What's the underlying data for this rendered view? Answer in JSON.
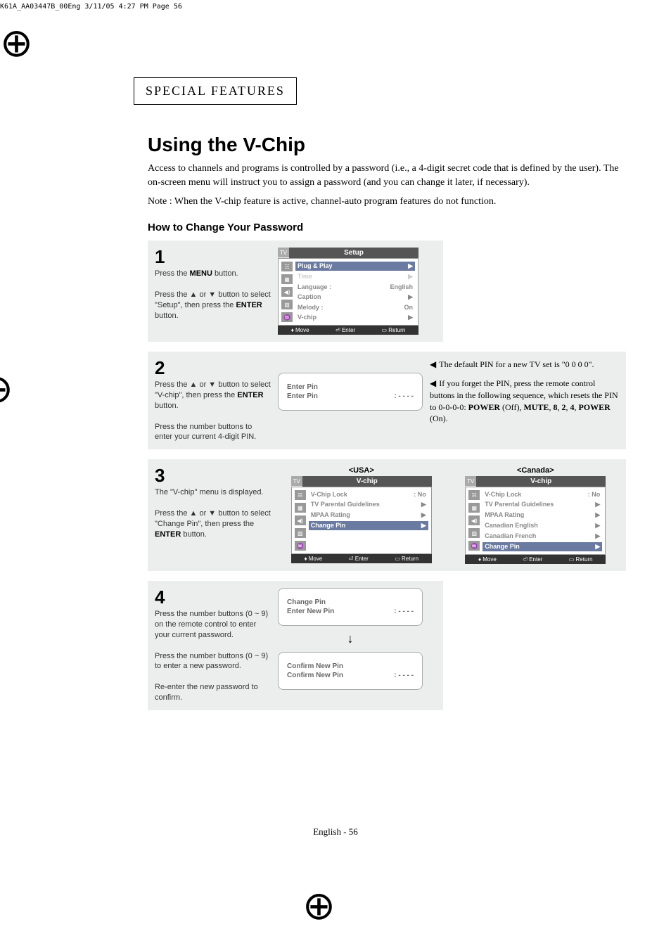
{
  "top_meta": "K61A_AA03447B_00Eng  3/11/05  4:27 PM  Page 56",
  "section_header": "SPECIAL FEATURES",
  "main_title": "Using the V-Chip",
  "intro": "Access to channels and programs is controlled by a password (i.e., a 4-digit secret code that is defined by the user). The on-screen menu will instruct you to assign a password (and you can change it later, if necessary).",
  "note": "Note : When the V-chip feature is active, channel-auto program features do not function.",
  "sub_heading": "How to Change Your Password",
  "step1": {
    "num": "1",
    "line1_pre": "Press the ",
    "line1_bold": "MENU",
    "line1_post": " button.",
    "line2_pre": "Press the ▲ or ▼ button to select \"Setup\", then press the ",
    "line2_bold": "ENTER",
    "line2_post": " button."
  },
  "osd_setup": {
    "title": "Setup",
    "items": [
      {
        "label": "Plug & Play",
        "val": "",
        "sel": true,
        "arrow": "▶"
      },
      {
        "label": "Time",
        "val": "",
        "arrow": "▶",
        "dim": true
      },
      {
        "label": "Language :",
        "val": "English"
      },
      {
        "label": "Caption",
        "val": "",
        "arrow": "▶"
      },
      {
        "label": "Melody  :",
        "val": "On"
      },
      {
        "label": "V-chip",
        "val": "",
        "arrow": "▶"
      }
    ],
    "footer": {
      "move": "Move",
      "enter": "Enter",
      "return": "Return"
    }
  },
  "step2": {
    "num": "2",
    "line1_pre": "Press the ▲ or ▼ button to select  \"V-chip\", then press the ",
    "line1_bold": "ENTER",
    "line1_post": " button.",
    "line2": "Press the number buttons to enter your current 4-digit PIN."
  },
  "pin_box": {
    "title": "Enter Pin",
    "row": "Enter Pin",
    "dots": ": - - - -"
  },
  "side_notes": {
    "n1": "The default PIN for a new TV set is \"0 0 0 0\".",
    "n2_pre": "If you forget the PIN, press the remote control buttons in the following sequence, which resets the PIN to 0-0-0-0: ",
    "n2_seq": "POWER (Off), MUTE, 8, 2, 4, POWER (On)."
  },
  "step3": {
    "num": "3",
    "line1": "The \"V-chip\" menu is displayed.",
    "line2_pre": "Press the ▲ or ▼ button to select \"Change Pin\", then press the ",
    "line2_bold": "ENTER",
    "line2_post": " button."
  },
  "usa_label": "<USA>",
  "canada_label": "<Canada>",
  "osd_vchip_usa": {
    "title": "V-chip",
    "items": [
      {
        "label": "V-Chip Lock",
        "val": ":  No"
      },
      {
        "label": "TV Parental Guidelines",
        "val": "",
        "arrow": "▶"
      },
      {
        "label": "MPAA Rating",
        "val": "",
        "arrow": "▶"
      },
      {
        "label": "Change Pin",
        "val": "",
        "sel": true,
        "arrow": "▶"
      }
    ]
  },
  "osd_vchip_can": {
    "title": "V-chip",
    "items": [
      {
        "label": "V-Chip Lock",
        "val": ":  No"
      },
      {
        "label": "TV Parental Guidelines",
        "val": "",
        "arrow": "▶"
      },
      {
        "label": "MPAA Rating",
        "val": "",
        "arrow": "▶"
      },
      {
        "label": "Canadian English",
        "val": "",
        "arrow": "▶"
      },
      {
        "label": "Canadian French",
        "val": "",
        "arrow": "▶"
      },
      {
        "label": "Change Pin",
        "val": "",
        "sel": true,
        "arrow": "▶"
      }
    ]
  },
  "osd_footer": {
    "move": "Move",
    "enter": "Enter",
    "return": "Return"
  },
  "step4": {
    "num": "4",
    "p1": "Press the number buttons (0 ~ 9) on the remote control to enter your current password.",
    "p2": "Press the number buttons (0 ~ 9) to enter a new password.",
    "p3": "Re-enter the new password to confirm."
  },
  "change_box": {
    "title": "Change Pin",
    "row": "Enter New Pin",
    "dots": ": - - - -"
  },
  "confirm_box": {
    "title": "Confirm New Pin",
    "row": "Confirm New Pin",
    "dots": ": - - - -"
  },
  "page_number": "English - 56"
}
